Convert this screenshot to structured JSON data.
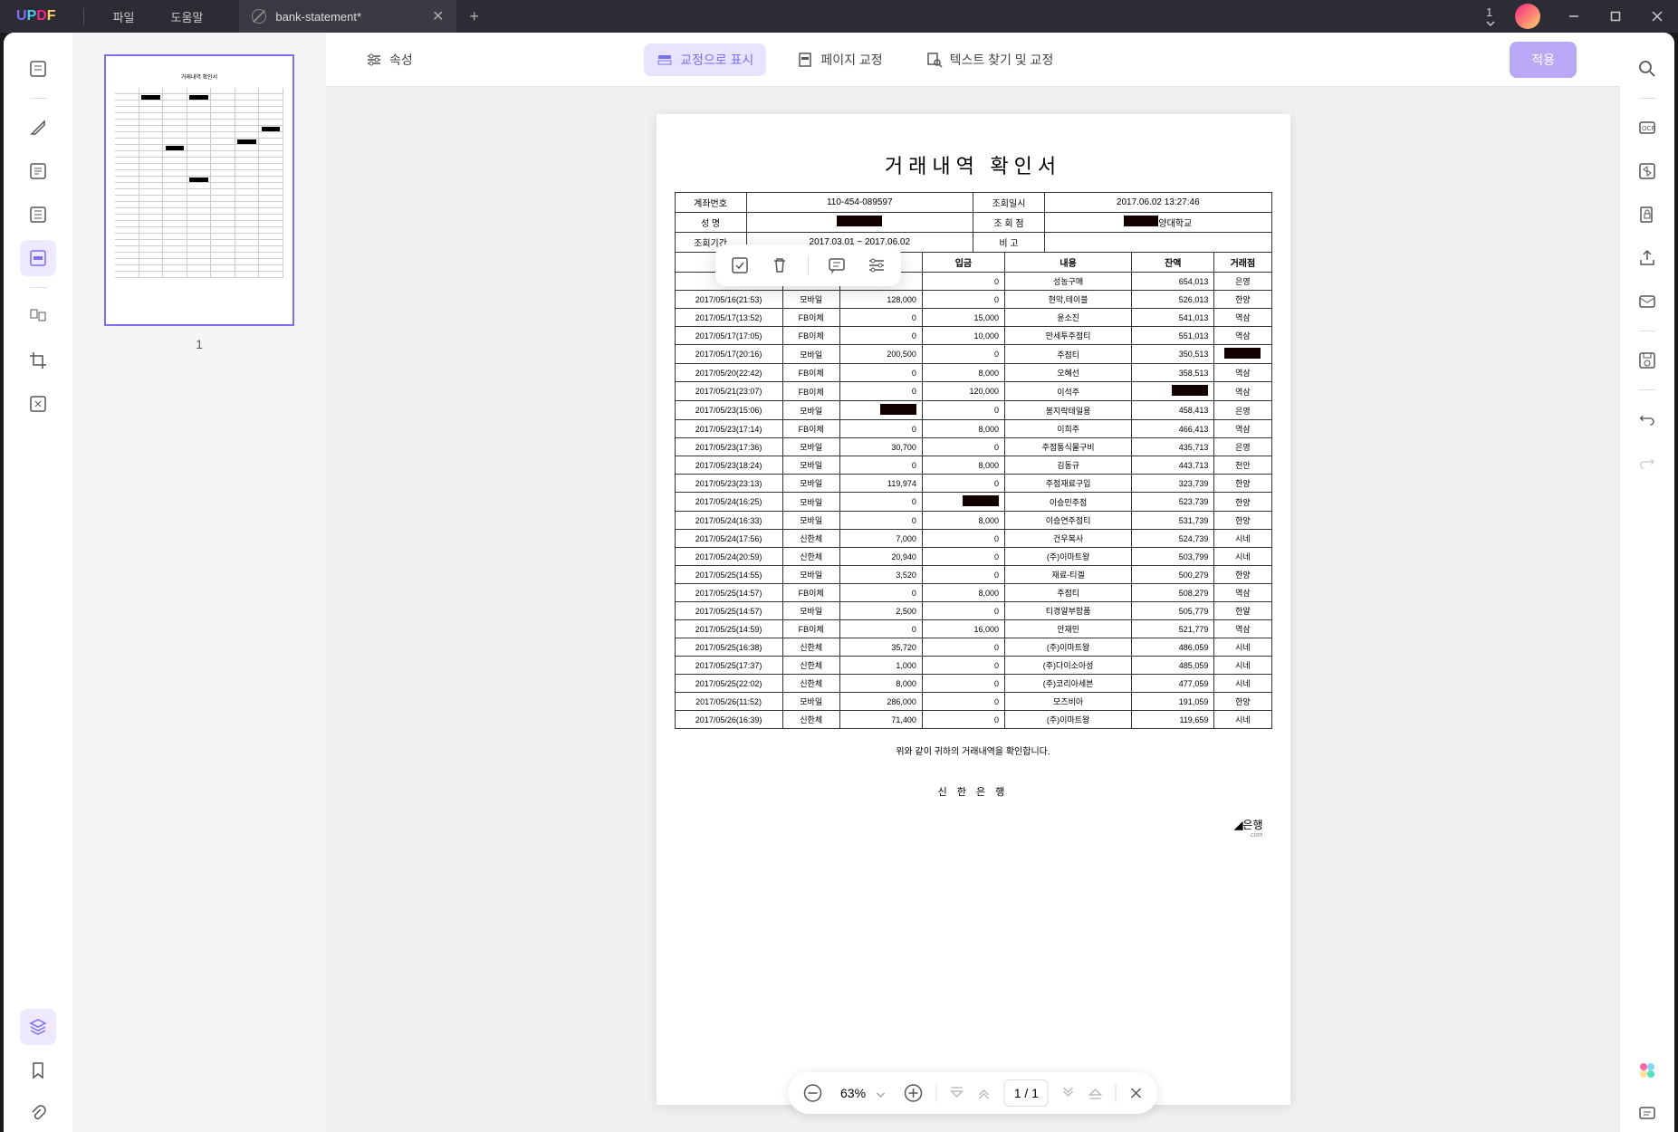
{
  "titlebar": {
    "menu_file": "파일",
    "menu_help": "도움말",
    "tab_title": "bank-statement*",
    "page_indicator": "1"
  },
  "toolbar": {
    "properties": "속성",
    "show_as_redaction": "교정으로 표시",
    "page_redaction": "페이지 교정",
    "find_redact_text": "텍스트 찾기 및 교정",
    "apply": "적용"
  },
  "thumbnail": {
    "page_num": "1"
  },
  "document": {
    "title": "거래내역 확인서",
    "header": {
      "account_no_label": "계좌번호",
      "account_no": "110-454-089597",
      "inquiry_date_label": "조회일시",
      "inquiry_date": "2017.06.02 13:27:46",
      "name_label": "성 명",
      "inquiry_dept_label": "조 회 점",
      "inquiry_dept_suffix": "양대학교",
      "period_label": "조회기간",
      "period": "2017.03.01 ~ 2017.06.02",
      "note_label": "비    고"
    },
    "columns": {
      "c1": "",
      "c2": "",
      "c3": "",
      "c4": "입금",
      "c5": "내용",
      "c6": "잔액",
      "c7": "거래점"
    },
    "rows": [
      {
        "dt": "",
        "ch": "",
        "out": "",
        "in": "0",
        "desc": "성농구매",
        "bal": "654,013",
        "br": "은영"
      },
      {
        "dt": "2017/05/16(21:53)",
        "ch": "모바일",
        "out": "128,000",
        "in": "0",
        "desc": "현막,테이블",
        "bal": "526,013",
        "br": "한양"
      },
      {
        "dt": "2017/05/17(13:52)",
        "ch": "FB이체",
        "out": "0",
        "in": "15,000",
        "desc": "윤소진",
        "bal": "541,013",
        "br": "역삼"
      },
      {
        "dt": "2017/05/17(17:05)",
        "ch": "FB이체",
        "out": "0",
        "in": "10,000",
        "desc": "만세투주점티",
        "bal": "551,013",
        "br": "역삼"
      },
      {
        "dt": "2017/05/17(20:16)",
        "ch": "모바일",
        "out": "200,500",
        "in": "0",
        "desc": "주점티",
        "bal": "350,513",
        "br": "REDACT"
      },
      {
        "dt": "2017/05/20(22:42)",
        "ch": "FB이체",
        "out": "0",
        "in": "8,000",
        "desc": "오혜선",
        "bal": "358,513",
        "br": "역삼"
      },
      {
        "dt": "2017/05/21(23:07)",
        "ch": "FB이체",
        "out": "0",
        "in": "120,000",
        "desc": "이석주",
        "bal": "REDACT",
        "br": "역삼"
      },
      {
        "dt": "2017/05/23(15:06)",
        "ch": "모바일",
        "out": "REDACT",
        "in": "0",
        "desc": "봉지락테일용",
        "bal": "458,413",
        "br": "은영"
      },
      {
        "dt": "2017/05/23(17:14)",
        "ch": "FB이체",
        "out": "0",
        "in": "8,000",
        "desc": "이희주",
        "bal": "466,413",
        "br": "역삼"
      },
      {
        "dt": "2017/05/23(17:36)",
        "ch": "모바일",
        "out": "30,700",
        "in": "0",
        "desc": "주점통식물구비",
        "bal": "435,713",
        "br": "은영"
      },
      {
        "dt": "2017/05/23(18:24)",
        "ch": "모바일",
        "out": "0",
        "in": "8,000",
        "desc": "김동규",
        "bal": "443,713",
        "br": "천안"
      },
      {
        "dt": "2017/05/23(23:13)",
        "ch": "모바일",
        "out": "119,974",
        "in": "0",
        "desc": "주점재료구입",
        "bal": "323,739",
        "br": "한양"
      },
      {
        "dt": "2017/05/24(16:25)",
        "ch": "모바일",
        "out": "0",
        "in": "REDACT",
        "desc": "이승민주점",
        "bal": "523,739",
        "br": "한양"
      },
      {
        "dt": "2017/05/24(16:33)",
        "ch": "모바일",
        "out": "0",
        "in": "8,000",
        "desc": "이승연주점티",
        "bal": "531,739",
        "br": "한양"
      },
      {
        "dt": "2017/05/24(17:56)",
        "ch": "신한체",
        "out": "7,000",
        "in": "0",
        "desc": "건우복사",
        "bal": "524,739",
        "br": "시네"
      },
      {
        "dt": "2017/05/24(20:59)",
        "ch": "신한체",
        "out": "20,940",
        "in": "0",
        "desc": "(주)이마트왕",
        "bal": "503,799",
        "br": "시네"
      },
      {
        "dt": "2017/05/25(14:55)",
        "ch": "모바일",
        "out": "3,520",
        "in": "0",
        "desc": "재료-티겔",
        "bal": "500,279",
        "br": "한양"
      },
      {
        "dt": "2017/05/25(14:57)",
        "ch": "FB이체",
        "out": "0",
        "in": "8,000",
        "desc": "주점티",
        "bal": "508,279",
        "br": "역삼"
      },
      {
        "dt": "2017/05/25(14:57)",
        "ch": "모바일",
        "out": "2,500",
        "in": "0",
        "desc": "티경얄부함품",
        "bal": "505,779",
        "br": "한얄"
      },
      {
        "dt": "2017/05/25(14:59)",
        "ch": "FB이체",
        "out": "0",
        "in": "16,000",
        "desc": "안재민",
        "bal": "521,779",
        "br": "역삼"
      },
      {
        "dt": "2017/05/25(16:38)",
        "ch": "신한체",
        "out": "35,720",
        "in": "0",
        "desc": "(주)이마트왕",
        "bal": "486,059",
        "br": "시네"
      },
      {
        "dt": "2017/05/25(17:37)",
        "ch": "신한체",
        "out": "1,000",
        "in": "0",
        "desc": "(주)다이소아성",
        "bal": "485,059",
        "br": "시네"
      },
      {
        "dt": "2017/05/25(22:02)",
        "ch": "신한체",
        "out": "8,000",
        "in": "0",
        "desc": "(주)코리아세븐",
        "bal": "477,059",
        "br": "시네"
      },
      {
        "dt": "2017/05/26(11:52)",
        "ch": "모바일",
        "out": "286,000",
        "in": "0",
        "desc": "모즈비아",
        "bal": "191,059",
        "br": "한양"
      },
      {
        "dt": "2017/05/26(16:39)",
        "ch": "신한체",
        "out": "71,400",
        "in": "0",
        "desc": "(주)이마트왕",
        "bal": "119,659",
        "br": "시네"
      }
    ],
    "footer_note": "위와 같이 귀하의 거래내역을 확인합니다.",
    "bank_name": "신 한 은 행",
    "bank_logo": "은행"
  },
  "page_nav": {
    "zoom": "63%",
    "page": "1 / 1"
  }
}
